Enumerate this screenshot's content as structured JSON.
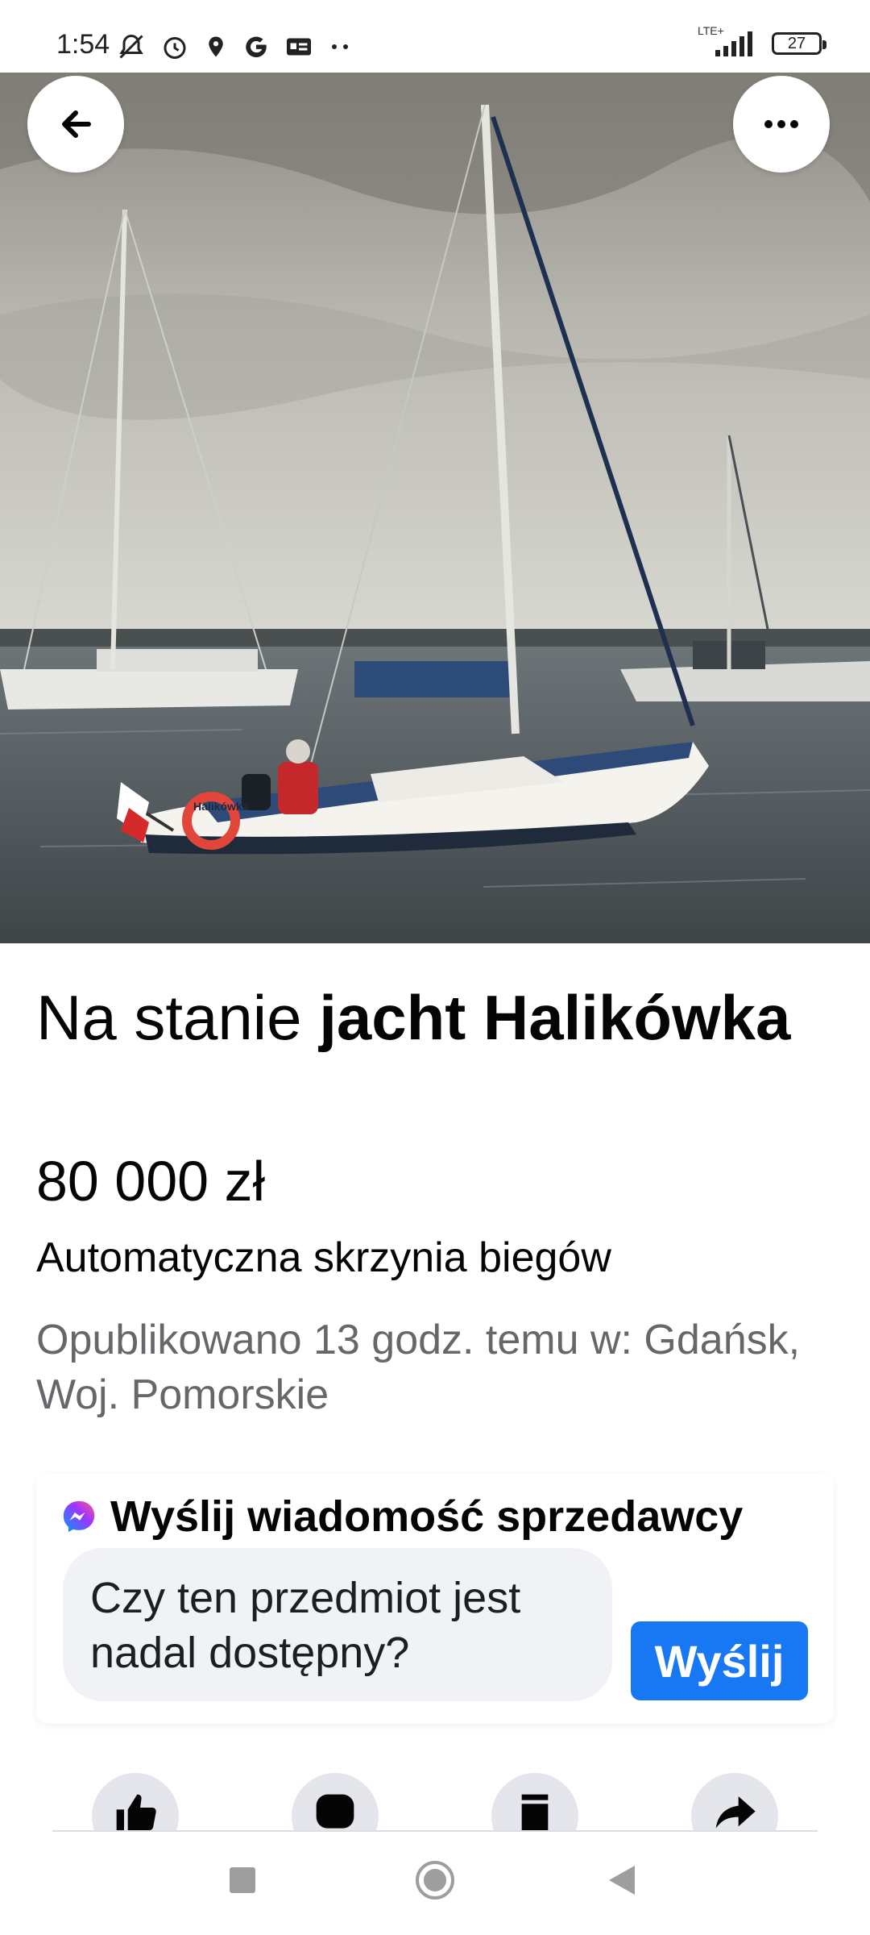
{
  "status_bar": {
    "time": "1:54",
    "network": "LTE+",
    "battery": "27"
  },
  "hero": {
    "boat_name": "Halikówka"
  },
  "listing": {
    "title_prefix": "Na stanie ",
    "title_bold": "jacht Halikówka",
    "price": "80 000 zł",
    "subtitle": "Automatyczna skrzynia biegów",
    "posted": "Opublikowano 13 godz. temu w: Gdańsk, Woj. Pomorskie"
  },
  "message": {
    "header": "Wyślij wiadomość sprzedawcy",
    "input_text": "Czy ten przedmiot jest nadal dostępny?",
    "send_label": "Wyślij"
  },
  "actions": [
    {
      "icon": "thumbs-up-icon"
    },
    {
      "icon": "messenger-icon"
    },
    {
      "icon": "bookmark-icon"
    },
    {
      "icon": "share-icon"
    }
  ],
  "colors": {
    "accent": "#1877f2",
    "secondary_text": "#65676b",
    "input_bg": "#f0f2f5"
  }
}
